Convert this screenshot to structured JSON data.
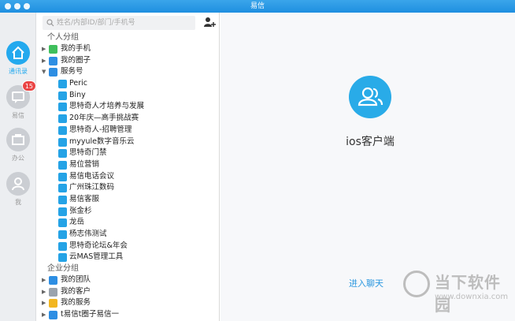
{
  "window": {
    "title": "易信"
  },
  "rail": {
    "items": [
      {
        "label": "通讯录",
        "icon": "house-icon",
        "active": true
      },
      {
        "label": "易信",
        "icon": "chat-bubble-icon",
        "badge": "15"
      },
      {
        "label": "办公",
        "icon": "briefcase-icon"
      },
      {
        "label": "我",
        "icon": "person-icon"
      }
    ]
  },
  "search": {
    "placeholder": "姓名/内部ID/部门/手机号",
    "value": ""
  },
  "toolbar": {
    "add_contact_icon": "add-contact-icon"
  },
  "groups": {
    "personal_title": "个人分组",
    "personal": [
      {
        "label": "我的手机",
        "color": "#3fbf5c",
        "expanded": false
      },
      {
        "label": "我的圈子",
        "color": "#2d8ee3",
        "expanded": false
      },
      {
        "label": "服务号",
        "color": "#2d8ee3",
        "expanded": true
      }
    ],
    "service_items": [
      "Peric",
      "Biny",
      "思特奇人才培养与发展",
      "20年庆—高手挑战赛",
      "思特奇人-招聘管理",
      "myyule数字音乐云",
      "思特奇门禁",
      "易位营销",
      "易信电话会议",
      "广州珠江数码",
      "易信客服",
      "张金杉",
      "龙岳",
      "杨志伟测试",
      "思特奇论坛&年会",
      "云MAS管理工具"
    ],
    "enterprise_title": "企业分组",
    "enterprise": [
      {
        "label": "我的团队",
        "color": "#2d8ee3"
      },
      {
        "label": "我的客户",
        "color": "#9aa3ad"
      },
      {
        "label": "我的服务",
        "color": "#f2b620"
      },
      {
        "label": "t易信t圈子易信一",
        "color": "#2d8ee3"
      }
    ]
  },
  "main": {
    "selected_name": "ios客户端",
    "enter_chat": "进入聊天",
    "accent": "#29abe8"
  },
  "watermark": {
    "text": "当下软件园",
    "url": "www.downxia.com"
  }
}
